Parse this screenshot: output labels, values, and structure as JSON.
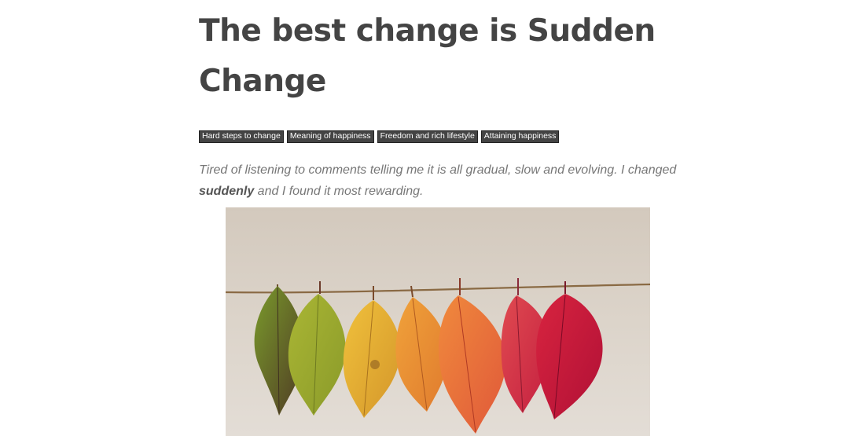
{
  "article": {
    "title": "The best change is Sudden Change",
    "tags": [
      "Hard steps to change",
      "Meaning of happiness",
      "Freedom and rich lifestyle",
      "Attaining happiness"
    ],
    "lead": {
      "before": "Tired of listening to comments telling me it is all gradual, slow and evolving. I changed ",
      "emphasis": "suddenly",
      "after": " and I found it most rewarding."
    },
    "image": {
      "subject": "leaves-on-string-photo",
      "background": "#d9d0c5",
      "leaf_colors": [
        "#6e8a2a",
        "#9aa830",
        "#e2a92e",
        "#e88a35",
        "#e86a38",
        "#cf2e45",
        "#c8173a"
      ]
    }
  }
}
